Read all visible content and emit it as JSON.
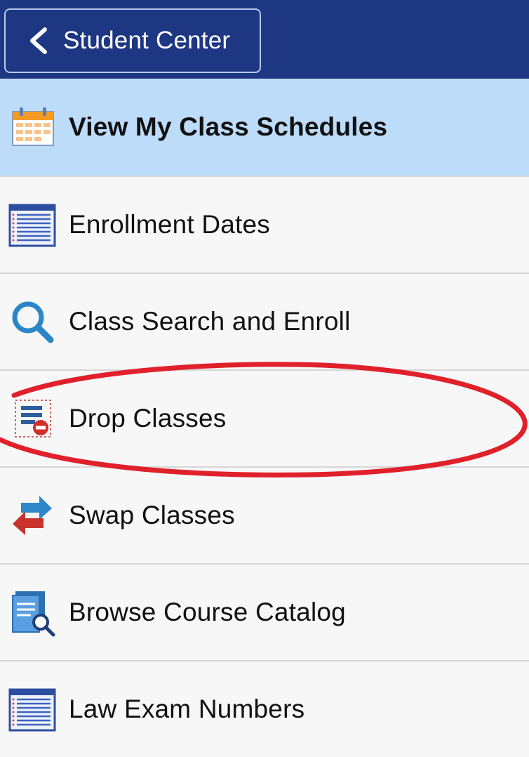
{
  "header": {
    "back_label": "Student Center",
    "bg_color": "#1e3783"
  },
  "menu": {
    "items": [
      {
        "label": "View My Class Schedules",
        "icon": "calendar-icon",
        "active": true
      },
      {
        "label": "Enrollment Dates",
        "icon": "list-icon",
        "active": false
      },
      {
        "label": "Class Search and Enroll",
        "icon": "search-icon",
        "active": false
      },
      {
        "label": "Drop Classes",
        "icon": "drop-class-icon",
        "active": false
      },
      {
        "label": "Swap Classes",
        "icon": "swap-arrows-icon",
        "active": false
      },
      {
        "label": "Browse Course Catalog",
        "icon": "catalog-search-icon",
        "active": false
      },
      {
        "label": "Law Exam Numbers",
        "icon": "list-icon",
        "active": false
      }
    ],
    "active_color": "#bcdcf9"
  },
  "annotation": {
    "type": "ellipse",
    "color": "#e0202a",
    "target": "Drop Classes"
  }
}
